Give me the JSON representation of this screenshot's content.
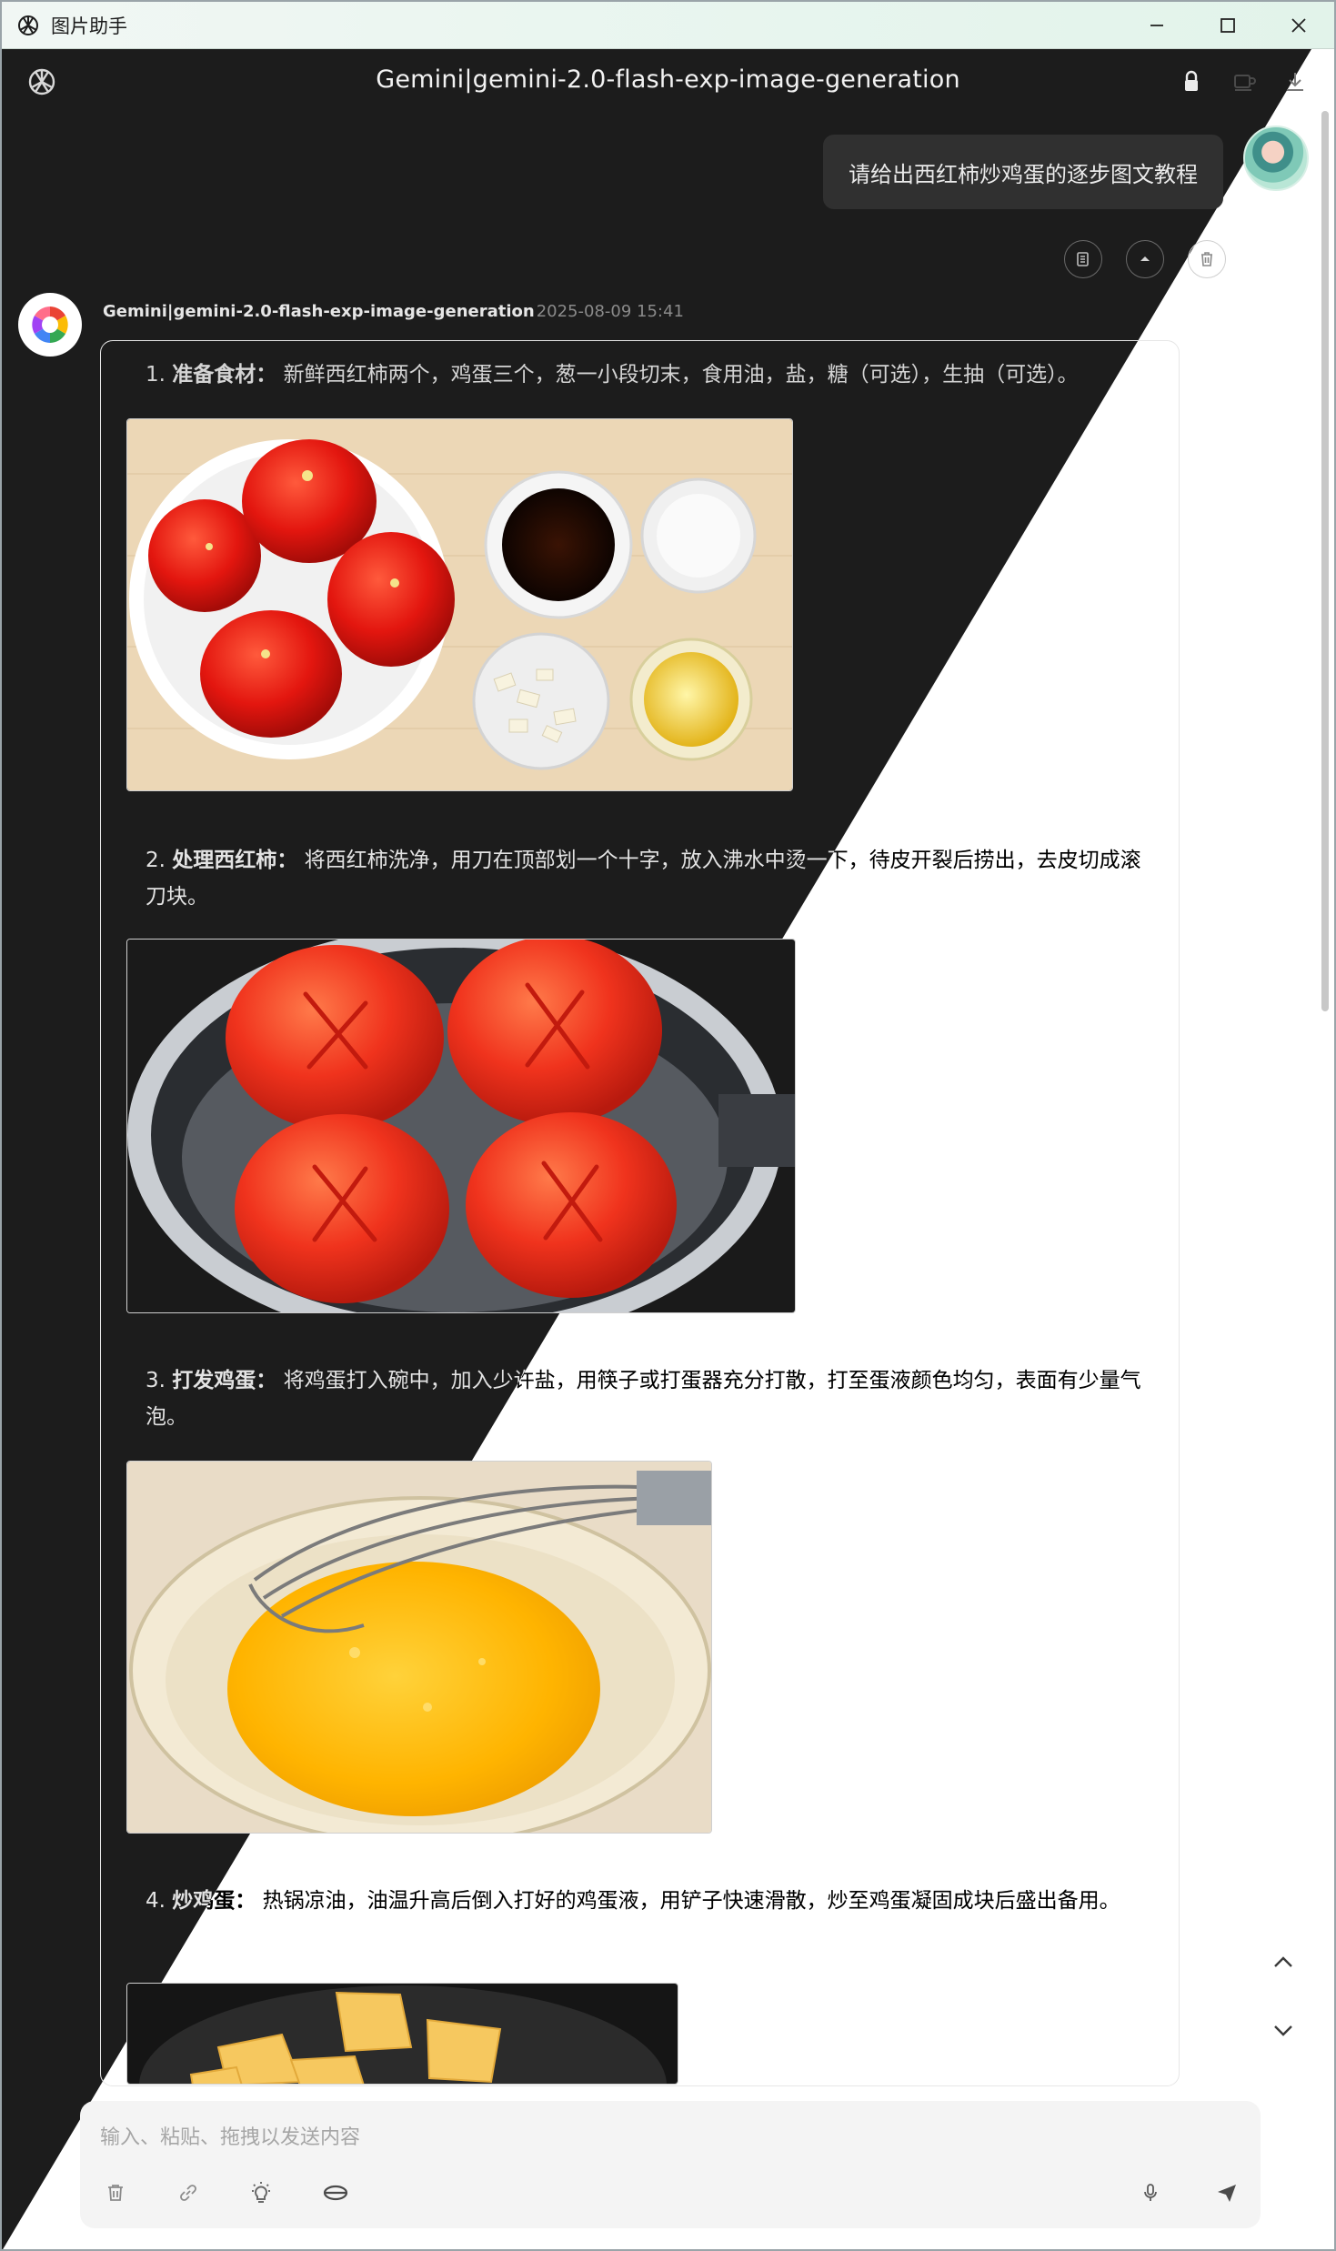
{
  "window": {
    "title": "图片助手",
    "controls": [
      "minimize",
      "maximize",
      "close"
    ]
  },
  "header": {
    "model_title": "Gemini|gemini-2.0-flash-exp-image-generation",
    "icons": [
      "lock-icon",
      "coffee-icon",
      "download-icon"
    ]
  },
  "user_message": {
    "text": "请给出西红柿炒鸡蛋的逐步图文教程"
  },
  "message_actions": [
    "copy-icon",
    "collapse-icon",
    "delete-icon"
  ],
  "assistant": {
    "name": "Gemini|gemini-2.0-flash-exp-image-generation",
    "timestamp": "2025-08-09 15:41",
    "steps": [
      {
        "num": "1.",
        "title": "准备食材：",
        "text": " 新鲜西红柿两个，鸡蛋三个，葱一小段切末，食用油，盐，糖（可选），生抽（可选）。",
        "image": "tomatoes-and-ingredients"
      },
      {
        "num": "2.",
        "title": "处理西红柿：",
        "text": " 将西红柿洗净，用刀在顶部划一个十字，放入沸水中烫一下，待皮开裂后捞出，去皮切成滚刀块。",
        "image": "scored-tomatoes-in-pot"
      },
      {
        "num": "3.",
        "title": "打发鸡蛋：",
        "text": " 将鸡蛋打入碗中，加入少许盐，用筷子或打蛋器充分打散，打至蛋液颜色均匀，表面有少量气泡。",
        "image": "whisked-eggs-in-bowl"
      },
      {
        "num": "4.",
        "title": "炒鸡蛋：",
        "text": " 热锅凉油，油温升高后倒入打好的鸡蛋液，用铲子快速滑散，炒至鸡蛋凝固成块后盛出备用。",
        "image": "scrambled-eggs-in-pan"
      }
    ]
  },
  "scroll": {
    "up": "chevron-up-icon",
    "down": "chevron-down-icon"
  },
  "composer": {
    "placeholder": "输入、粘贴、拖拽以发送内容",
    "icons": [
      "trash-icon",
      "link-icon",
      "bulb-icon",
      "network-icon",
      "mic-icon",
      "send-icon"
    ]
  }
}
